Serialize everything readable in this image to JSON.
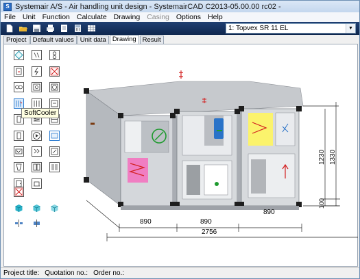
{
  "window": {
    "title": "Systemair A/S - Air handling unit design - SystemairCAD C2013-05.00.00 rc02 -",
    "app_icon_letter": "S"
  },
  "menu": {
    "items": [
      {
        "label": "File",
        "disabled": false
      },
      {
        "label": "Unit",
        "disabled": false
      },
      {
        "label": "Function",
        "disabled": false
      },
      {
        "label": "Calculate",
        "disabled": false
      },
      {
        "label": "Drawing",
        "disabled": false
      },
      {
        "label": "Casing",
        "disabled": true
      },
      {
        "label": "Options",
        "disabled": false
      },
      {
        "label": "Help",
        "disabled": false
      }
    ]
  },
  "toolbar": {
    "buttons": [
      "new-file-icon",
      "open-folder-icon",
      "save-icon",
      "print-icon",
      "document-icon",
      "calculator-icon",
      "table-icon"
    ],
    "unit_select": "1: Topvex SR 11 EL"
  },
  "tabs": [
    {
      "label": "Project",
      "active": false
    },
    {
      "label": "Default values",
      "active": false
    },
    {
      "label": "Unit data",
      "active": false
    },
    {
      "label": "Drawing",
      "active": true
    },
    {
      "label": "Result",
      "active": false
    }
  ],
  "tooltip": "SoftCooler",
  "drawing": {
    "dim_overall_length": "2756",
    "dim_section_1": "890",
    "dim_section_2": "890",
    "dim_section_3": "890",
    "dim_height_inner": "1230",
    "dim_height_outer": "1330",
    "dim_base": "100",
    "colors": {
      "casing": "#cfd2d6",
      "casing_dark": "#a9adb3",
      "corner": "#1e1e1e",
      "filter_pink": "#f07ec2",
      "filter_yellow": "#fbf36c",
      "fan_blue": "#2a73c8",
      "accent_red": "#d32020",
      "accent_green": "#1e9a2e"
    }
  },
  "status": {
    "project_title_label": "Project title:",
    "quotation_label": "Quotation no.:",
    "order_label": "Order no.:"
  }
}
